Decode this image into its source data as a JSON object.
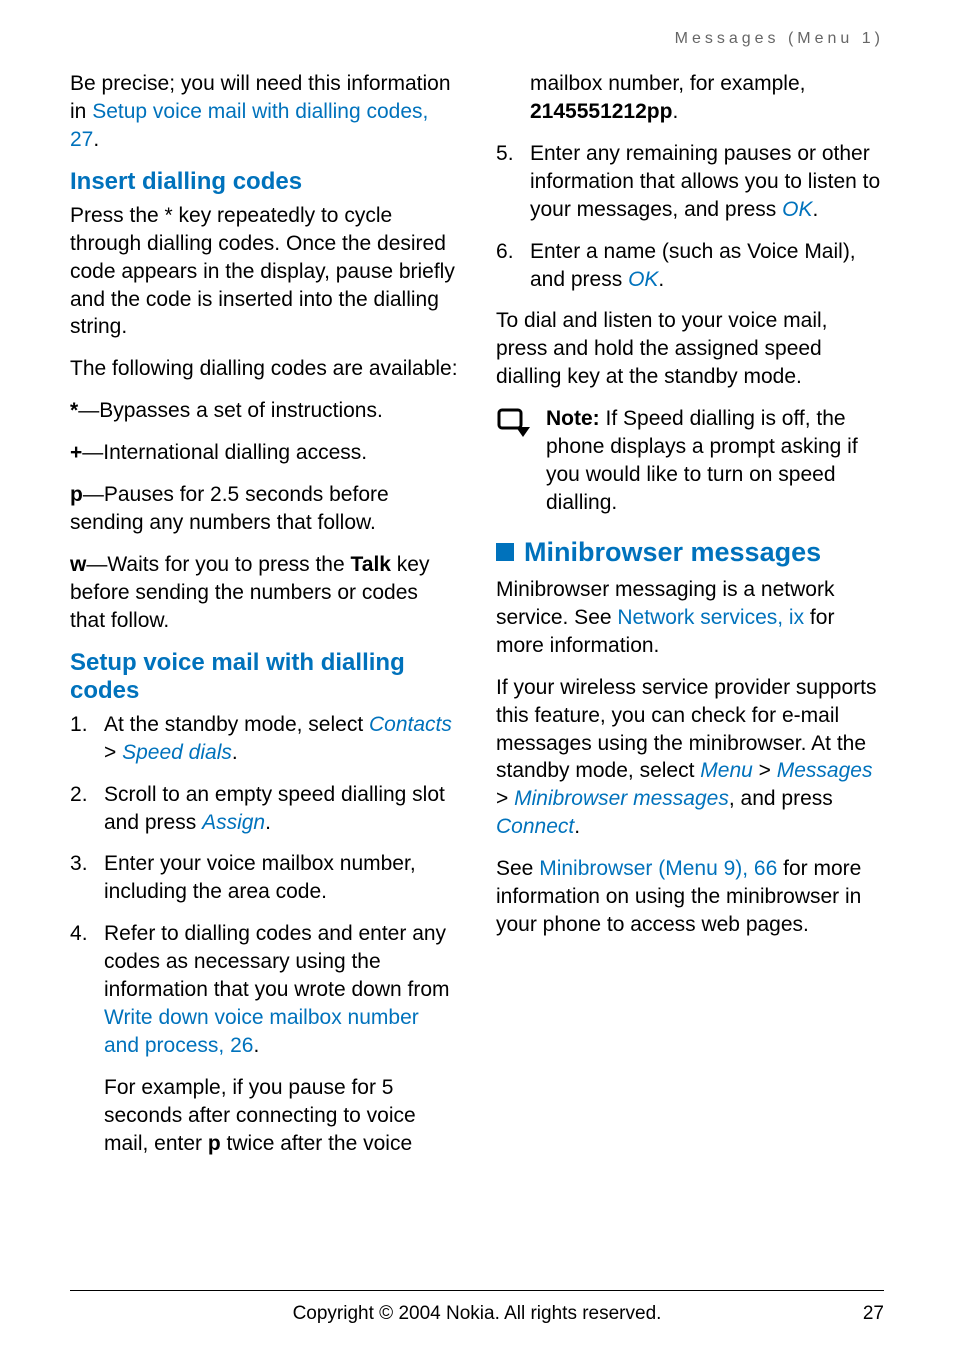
{
  "running_head": "Messages (Menu 1)",
  "left": {
    "intro": {
      "p1a": "Be precise; you will need this information in ",
      "link1": "Setup voice mail with dialling codes, 27",
      "p1b": "."
    },
    "h_insert": "Insert dialling codes",
    "insert_p1": "Press the * key repeatedly to cycle through dialling codes. Once the desired code appears in the display, pause briefly and the code is inserted into the dialling string.",
    "insert_p2": "The following dialling codes are available:",
    "codes": {
      "star_sym": "*",
      "star_txt": "—Bypasses a set of instructions.",
      "plus_sym": "+",
      "plus_txt": "—International dialling access.",
      "p_sym": "p",
      "p_txt": "—Pauses for 2.5 seconds before sending any numbers that follow.",
      "w_sym": "w",
      "w_txt_a": "—Waits for you to press the ",
      "w_key": "Talk",
      "w_txt_b": " key before sending the numbers or codes that follow."
    },
    "h_setup": "Setup voice mail with dialling codes",
    "ol": {
      "s1_a": "At the standby mode, select ",
      "s1_contacts": "Contacts",
      "s1_gt": " > ",
      "s1_speed": "Speed dials",
      "s1_b": ".",
      "s2_a": "Scroll to an empty speed dialling slot and press ",
      "s2_assign": "Assign",
      "s2_b": ".",
      "s3": "Enter your voice mailbox number, including the area code.",
      "s4_a": "Refer to dialling codes and enter any codes as necessary using the information that you wrote down from ",
      "s4_link": "Write down voice mailbox number and process, 26",
      "s4_b": ".",
      "s4_sub_a": "For example, if you pause for 5 seconds after connecting to voice mail, enter ",
      "s4_sub_p": "p",
      "s4_sub_b": " twice after the voice"
    }
  },
  "right": {
    "cont_a": "mailbox number, for example, ",
    "cont_num": "2145551212pp",
    "cont_b": ".",
    "s5_a": "Enter any remaining pauses or other information that allows you to listen to your messages, and press ",
    "s5_ok": "OK",
    "s5_b": ".",
    "s6_a": "Enter a name (such as Voice Mail), and press ",
    "s6_ok": "OK",
    "s6_b": ".",
    "after_p": "To dial and listen to your voice mail, press and hold the assigned speed dialling key at the standby mode.",
    "note_label": "Note:",
    "note_txt": " If Speed dialling is off, the phone displays a prompt asking if you would like to turn on speed dialling.",
    "h_mini": "Minibrowser messages",
    "mini_p1_a": "Minibrowser messaging is a network service. See ",
    "mini_p1_link": "Network services, ix",
    "mini_p1_b": " for more information.",
    "mini_p2_a": "If your wireless service provider supports this feature, you can check for e-mail messages using the minibrowser. At the standby mode, select ",
    "mini_menu": "Menu",
    "mini_gt1": " > ",
    "mini_msgs": "Messages",
    "mini_gt2": " > ",
    "mini_mb": "Minibrowser messages",
    "mini_p2_b": ", and press ",
    "mini_connect": "Connect",
    "mini_p2_c": ".",
    "mini_p3_a": "See ",
    "mini_p3_link": "Minibrowser (Menu 9), 66",
    "mini_p3_b": " for more information on using the minibrowser in your phone to access web pages."
  },
  "footer": {
    "copyright": "Copyright © 2004 Nokia. All rights reserved.",
    "page": "27"
  }
}
